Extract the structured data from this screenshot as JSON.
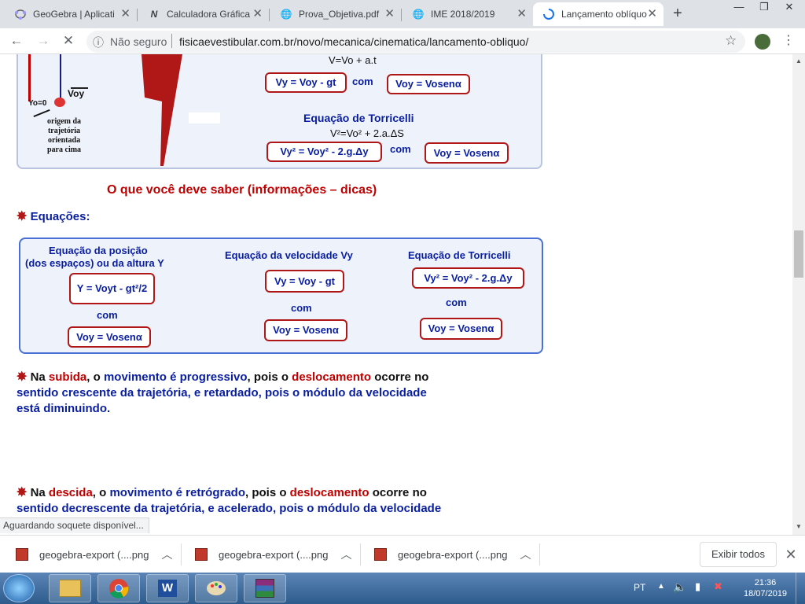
{
  "tabs": [
    {
      "title": "GeoGebra | Aplicati",
      "icon": "geogebra-icon"
    },
    {
      "title": "Calculadora Gráfica",
      "icon": "graph-icon"
    },
    {
      "title": "Prova_Objetiva.pdf",
      "icon": "globe-icon"
    },
    {
      "title": "IME 2018/2019",
      "icon": "globe-icon"
    },
    {
      "title": "Lançamento oblíquo",
      "icon": "loading-icon"
    }
  ],
  "toolbar": {
    "security_text": "Não seguro",
    "url": "fisicaevestibular.com.br/novo/mecanica/cinematica/lancamento-obliquo/"
  },
  "top_figure": {
    "voy_label": "Voy",
    "y0_label": "Yo=0",
    "origin_text": [
      "origem da",
      "trajetória",
      "orientada",
      "para cima"
    ],
    "velocity_eq": "V=Vo + a.t",
    "vy_eq": "Vy = Voy - gt",
    "com": "com",
    "voy_eq": "Voy = Vosenα",
    "torricelli_title": "Equação de Torricelli",
    "torricelli_general": "V²=Vo² + 2.a.ΔS",
    "torricelli_eq": "Vy² = Voy² - 2.g.Δy",
    "com2": "com",
    "voy_eq2": "Voy = Vosenα"
  },
  "section_title": "O que você deve saber (informações – dicas)",
  "equacoes_label": "Equações:",
  "equations_box": {
    "pos_title_1": "Equação da posição",
    "pos_title_2": "(dos espaços) ou da altura Y",
    "pos_eq": "Y = Voyt - gt²/2",
    "pos_com": "com",
    "pos_voy": "Voy = Vosenα",
    "vel_title": "Equação da velocidade Vy",
    "vel_eq": "Vy = Voy - gt",
    "vel_com": "com",
    "vel_voy": "Voy = Vosenα",
    "tor_title": "Equação de Torricelli",
    "tor_eq": "Vy² = Voy² - 2.g.Δy",
    "tor_com": "com",
    "tor_voy": "Voy = Vosenα"
  },
  "para1": {
    "p1": "Na ",
    "p2": "subida",
    "p3": ", o ",
    "p4": "movimento é progressivo",
    "p5": ", pois o ",
    "p6": "deslocamento",
    "p7": " ocorre no",
    "line2": "sentido crescente da trajetória, e retardado, pois o módulo da velocidade",
    "line3": "está diminuindo."
  },
  "para2": {
    "p1": "Na ",
    "p2": "descida",
    "p3": ", o ",
    "p4": "movimento é retrógrado",
    "p5": ", pois o ",
    "p6": "deslocamento",
    "p7": " ocorre no",
    "line2": "sentido decrescente da trajetória, e acelerado, pois o módulo da velocidade"
  },
  "status_text": "Aguardando soquete disponível...",
  "downloads": [
    {
      "name": "geogebra-export (....png"
    },
    {
      "name": "geogebra-export (....png"
    },
    {
      "name": "geogebra-export (....png"
    }
  ],
  "show_all": "Exibir todos",
  "tray": {
    "lang": "PT",
    "time": "21:36",
    "date": "18/07/2019"
  },
  "colors": {
    "accent_red": "#c00000",
    "eq_blue": "#0a1fa0",
    "box_border": "#b9c3e0"
  }
}
